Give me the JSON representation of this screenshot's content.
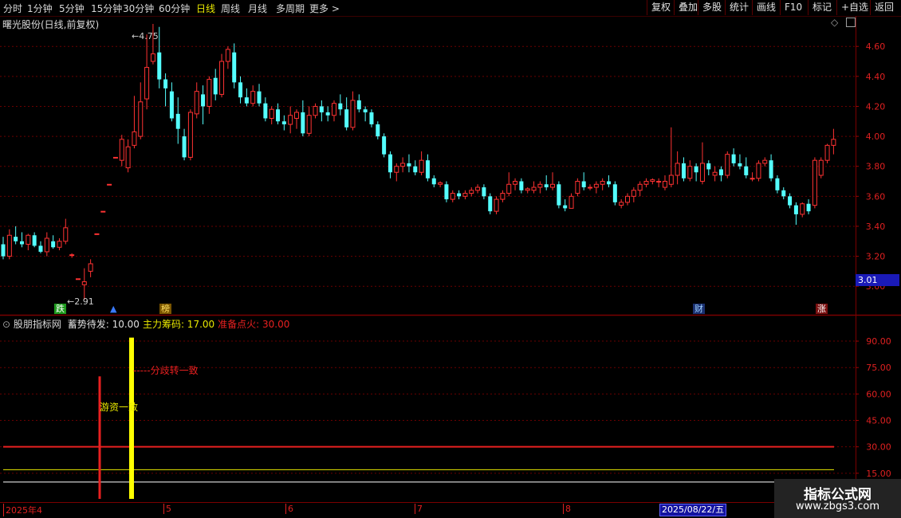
{
  "toolbar": {
    "periods": [
      "分时",
      "1分钟",
      "5分钟",
      "15分钟",
      "30分钟",
      "60分钟",
      "日线",
      "周线",
      "月线",
      "多周期",
      "更多"
    ],
    "active_period": "日线",
    "right_buttons": [
      "复权",
      "叠加",
      "多股",
      "统计",
      "画线",
      "F10",
      "标记",
      "+自选",
      "返回"
    ]
  },
  "chart_title": "曙光股份(日线,前复权)",
  "price_axis": {
    "ticks": [
      "4.60",
      "4.40",
      "4.20",
      "4.00",
      "3.80",
      "3.60",
      "3.40",
      "3.20",
      "3.00"
    ],
    "min": 2.9,
    "max": 4.75
  },
  "current_price": "3.01",
  "annotations": {
    "high": "4.75",
    "low": "2.91"
  },
  "event_tags": [
    {
      "text": "跌",
      "color": "#1d9a1d",
      "fg": "#ffffff"
    },
    {
      "text": "▲",
      "color": "#000000",
      "fg": "#3a7bff"
    },
    {
      "text": "榜",
      "color": "#7a5500",
      "fg": "#ffdf60"
    },
    {
      "text": "财",
      "color": "#1a3070",
      "fg": "#9fd0ff"
    },
    {
      "text": "涨",
      "color": "#7a1010",
      "fg": "#ffffff"
    }
  ],
  "indicator": {
    "name": "股朋指标网",
    "params": [
      {
        "label": "蓄势待发:",
        "value": "10.00",
        "color": "#e0e0e0"
      },
      {
        "label": "主力筹码:",
        "value": "17.00",
        "color": "#e8e800"
      },
      {
        "label": "准备点火:",
        "value": "30.00",
        "color": "#e82020"
      }
    ],
    "y_ticks": [
      "90.00",
      "75.00",
      "60.00",
      "45.00",
      "30.00",
      "15.00"
    ],
    "ymin": 0,
    "ymax": 95,
    "labels": {
      "diverge": "分歧转一致",
      "hot_money": "游资一致"
    },
    "bars": [
      {
        "color": "#e82020",
        "value": 70
      },
      {
        "color": "#ffff00",
        "value": 92
      }
    ],
    "levels": [
      {
        "value": 30,
        "color": "#e82020"
      },
      {
        "value": 17,
        "color": "#e8e800"
      },
      {
        "value": 10,
        "color": "#ffffff"
      }
    ]
  },
  "date_axis": {
    "labels": [
      "2025年4",
      "5",
      "6",
      "7",
      "8"
    ],
    "cursor_date": "2025/08/22/五"
  },
  "watermark": {
    "line1": "指标公式网",
    "line2": "www.zbgs3.com"
  },
  "chart_data": {
    "type": "candlestick",
    "note_ohlc_order": "open,high,low,close",
    "candles": [
      [
        3.28,
        3.33,
        3.18,
        3.2
      ],
      [
        3.2,
        3.38,
        3.18,
        3.34
      ],
      [
        3.33,
        3.4,
        3.28,
        3.3
      ],
      [
        3.3,
        3.36,
        3.26,
        3.28
      ],
      [
        3.28,
        3.35,
        3.24,
        3.34
      ],
      [
        3.34,
        3.36,
        3.26,
        3.27
      ],
      [
        3.27,
        3.3,
        3.22,
        3.23
      ],
      [
        3.23,
        3.36,
        3.2,
        3.32
      ],
      [
        3.3,
        3.34,
        3.25,
        3.26
      ],
      [
        3.26,
        3.32,
        3.24,
        3.3
      ],
      [
        3.3,
        3.45,
        3.28,
        3.39
      ],
      [
        3.21,
        3.22,
        3.19,
        3.21
      ],
      [
        3.05,
        3.05,
        3.05,
        3.05
      ],
      [
        3.01,
        3.12,
        2.91,
        3.03
      ],
      [
        3.1,
        3.18,
        3.06,
        3.15
      ],
      [
        3.35,
        3.35,
        3.35,
        3.35
      ],
      [
        3.5,
        3.5,
        3.5,
        3.5
      ],
      [
        3.68,
        3.68,
        3.68,
        3.68
      ],
      [
        3.86,
        3.86,
        3.86,
        3.86
      ],
      [
        3.84,
        4.01,
        3.8,
        3.98
      ],
      [
        3.79,
        3.98,
        3.76,
        3.93
      ],
      [
        3.94,
        4.27,
        3.92,
        4.03
      ],
      [
        4.0,
        4.36,
        3.98,
        4.23
      ],
      [
        4.25,
        4.68,
        4.18,
        4.46
      ],
      [
        4.5,
        4.75,
        4.48,
        4.55
      ],
      [
        4.56,
        4.73,
        4.32,
        4.38
      ],
      [
        4.38,
        4.42,
        4.2,
        4.32
      ],
      [
        4.3,
        4.36,
        4.1,
        4.12
      ],
      [
        4.15,
        4.26,
        3.95,
        4.05
      ],
      [
        4.0,
        4.05,
        3.84,
        3.86
      ],
      [
        3.86,
        4.18,
        3.84,
        4.16
      ],
      [
        4.15,
        4.36,
        4.12,
        4.3
      ],
      [
        4.28,
        4.34,
        4.08,
        4.2
      ],
      [
        4.2,
        4.4,
        4.15,
        4.38
      ],
      [
        4.39,
        4.45,
        4.24,
        4.28
      ],
      [
        4.28,
        4.55,
        4.26,
        4.5
      ],
      [
        4.5,
        4.6,
        4.45,
        4.58
      ],
      [
        4.56,
        4.62,
        4.32,
        4.36
      ],
      [
        4.36,
        4.4,
        4.22,
        4.26
      ],
      [
        4.26,
        4.32,
        4.2,
        4.22
      ],
      [
        4.22,
        4.34,
        4.2,
        4.3
      ],
      [
        4.3,
        4.35,
        4.2,
        4.22
      ],
      [
        4.22,
        4.26,
        4.1,
        4.12
      ],
      [
        4.12,
        4.2,
        4.08,
        4.18
      ],
      [
        4.18,
        4.22,
        4.08,
        4.1
      ],
      [
        4.1,
        4.14,
        4.04,
        4.08
      ],
      [
        4.08,
        4.2,
        4.02,
        4.14
      ],
      [
        4.12,
        4.18,
        4.05,
        4.16
      ],
      [
        4.16,
        4.24,
        4.0,
        4.02
      ],
      [
        4.02,
        4.2,
        4.0,
        4.14
      ],
      [
        4.14,
        4.22,
        4.12,
        4.2
      ],
      [
        4.2,
        4.24,
        4.1,
        4.16
      ],
      [
        4.16,
        4.2,
        4.1,
        4.14
      ],
      [
        4.14,
        4.24,
        4.1,
        4.22
      ],
      [
        4.22,
        4.28,
        4.14,
        4.18
      ],
      [
        4.18,
        4.26,
        4.04,
        4.06
      ],
      [
        4.06,
        4.3,
        4.04,
        4.24
      ],
      [
        4.24,
        4.28,
        4.16,
        4.18
      ],
      [
        4.18,
        4.2,
        4.1,
        4.16
      ],
      [
        4.16,
        4.18,
        4.06,
        4.08
      ],
      [
        4.08,
        4.1,
        3.98,
        4.0
      ],
      [
        4.0,
        4.02,
        3.86,
        3.88
      ],
      [
        3.88,
        3.9,
        3.72,
        3.76
      ],
      [
        3.76,
        3.82,
        3.7,
        3.8
      ],
      [
        3.8,
        3.86,
        3.76,
        3.82
      ],
      [
        3.82,
        3.88,
        3.76,
        3.8
      ],
      [
        3.8,
        3.84,
        3.74,
        3.76
      ],
      [
        3.76,
        3.9,
        3.74,
        3.84
      ],
      [
        3.84,
        3.88,
        3.7,
        3.72
      ],
      [
        3.72,
        3.74,
        3.66,
        3.68
      ],
      [
        3.68,
        3.7,
        3.66,
        3.69
      ],
      [
        3.68,
        3.7,
        3.56,
        3.58
      ],
      [
        3.58,
        3.64,
        3.56,
        3.62
      ],
      [
        3.62,
        3.64,
        3.58,
        3.6
      ],
      [
        3.6,
        3.64,
        3.58,
        3.62
      ],
      [
        3.62,
        3.66,
        3.6,
        3.64
      ],
      [
        3.64,
        3.68,
        3.62,
        3.66
      ],
      [
        3.66,
        3.68,
        3.58,
        3.6
      ],
      [
        3.6,
        3.62,
        3.48,
        3.5
      ],
      [
        3.5,
        3.6,
        3.48,
        3.58
      ],
      [
        3.58,
        3.64,
        3.56,
        3.62
      ],
      [
        3.62,
        3.76,
        3.6,
        3.68
      ],
      [
        3.68,
        3.72,
        3.64,
        3.7
      ],
      [
        3.7,
        3.72,
        3.62,
        3.64
      ],
      [
        3.64,
        3.66,
        3.62,
        3.65
      ],
      [
        3.64,
        3.7,
        3.62,
        3.66
      ],
      [
        3.66,
        3.7,
        3.62,
        3.68
      ],
      [
        3.68,
        3.74,
        3.64,
        3.66
      ],
      [
        3.66,
        3.76,
        3.64,
        3.68
      ],
      [
        3.68,
        3.7,
        3.52,
        3.54
      ],
      [
        3.54,
        3.58,
        3.5,
        3.52
      ],
      [
        3.52,
        3.62,
        3.52,
        3.6
      ],
      [
        3.62,
        3.72,
        3.6,
        3.7
      ],
      [
        3.7,
        3.76,
        3.64,
        3.66
      ],
      [
        3.66,
        3.68,
        3.64,
        3.66
      ],
      [
        3.66,
        3.7,
        3.62,
        3.68
      ],
      [
        3.68,
        3.72,
        3.64,
        3.7
      ],
      [
        3.7,
        3.74,
        3.66,
        3.68
      ],
      [
        3.68,
        3.7,
        3.54,
        3.56
      ],
      [
        3.54,
        3.58,
        3.52,
        3.56
      ],
      [
        3.56,
        3.62,
        3.54,
        3.6
      ],
      [
        3.6,
        3.66,
        3.56,
        3.64
      ],
      [
        3.64,
        3.7,
        3.6,
        3.68
      ],
      [
        3.68,
        3.72,
        3.66,
        3.7
      ],
      [
        3.7,
        3.72,
        3.68,
        3.71
      ],
      [
        3.7,
        3.72,
        3.66,
        3.7
      ],
      [
        3.66,
        3.74,
        3.64,
        3.7
      ],
      [
        3.68,
        4.06,
        3.66,
        3.74
      ],
      [
        3.74,
        3.9,
        3.68,
        3.82
      ],
      [
        3.82,
        3.86,
        3.7,
        3.72
      ],
      [
        3.72,
        3.84,
        3.7,
        3.8
      ],
      [
        3.8,
        3.82,
        3.7,
        3.76
      ],
      [
        3.7,
        3.96,
        3.68,
        3.82
      ],
      [
        3.82,
        3.84,
        3.74,
        3.78
      ],
      [
        3.74,
        3.8,
        3.7,
        3.76
      ],
      [
        3.78,
        3.8,
        3.7,
        3.74
      ],
      [
        3.74,
        3.9,
        3.72,
        3.88
      ],
      [
        3.88,
        3.92,
        3.8,
        3.82
      ],
      [
        3.82,
        3.88,
        3.78,
        3.8
      ],
      [
        3.8,
        3.86,
        3.72,
        3.74
      ],
      [
        3.72,
        3.76,
        3.7,
        3.72
      ],
      [
        3.72,
        3.84,
        3.7,
        3.82
      ],
      [
        3.82,
        3.86,
        3.8,
        3.84
      ],
      [
        3.84,
        3.88,
        3.7,
        3.72
      ],
      [
        3.72,
        3.74,
        3.62,
        3.64
      ],
      [
        3.64,
        3.66,
        3.58,
        3.6
      ],
      [
        3.6,
        3.62,
        3.52,
        3.54
      ],
      [
        3.54,
        3.56,
        3.41,
        3.48
      ],
      [
        3.48,
        3.56,
        3.46,
        3.55
      ],
      [
        3.55,
        3.58,
        3.48,
        3.5
      ],
      [
        3.54,
        3.86,
        3.52,
        3.84
      ],
      [
        3.74,
        3.86,
        3.72,
        3.84
      ],
      [
        3.84,
        3.95,
        3.82,
        3.94
      ],
      [
        3.94,
        4.05,
        3.88,
        3.98
      ]
    ]
  }
}
